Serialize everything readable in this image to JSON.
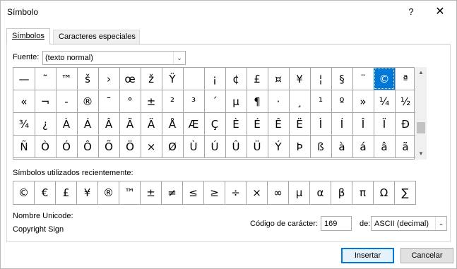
{
  "window": {
    "title": "Símbolo",
    "help_label": "?",
    "close_label": "✕"
  },
  "tabs": [
    {
      "label": "Símbolos",
      "active": true
    },
    {
      "label": "Caracteres especiales",
      "active": false
    }
  ],
  "font": {
    "label": "Fuente:",
    "value": "(texto normal)",
    "dropdown_icon": "chevron-down-icon"
  },
  "symbol_grid": {
    "rows": [
      [
        "—",
        "˜",
        "™",
        "š",
        "›",
        "œ",
        "ž",
        "Ÿ",
        " ",
        "¡",
        "¢",
        "£",
        "¤",
        "¥",
        "¦",
        "§",
        "¨",
        "©",
        "ª"
      ],
      [
        "«",
        "¬",
        "-",
        "®",
        "¯",
        "°",
        "±",
        "²",
        "³",
        "´",
        "µ",
        "¶",
        "·",
        "¸",
        "¹",
        "º",
        "»",
        "¼",
        "½"
      ],
      [
        "¾",
        "¿",
        "À",
        "Á",
        "Â",
        "Ã",
        "Ä",
        "Å",
        "Æ",
        "Ç",
        "È",
        "É",
        "Ê",
        "Ë",
        "Ì",
        "Í",
        "Î",
        "Ï",
        "Ð"
      ],
      [
        "Ñ",
        "Ò",
        "Ó",
        "Ô",
        "Õ",
        "Ö",
        "×",
        "Ø",
        "Ù",
        "Ú",
        "Û",
        "Ü",
        "Ý",
        "Þ",
        "ß",
        "à",
        "á",
        "â",
        "ã"
      ]
    ],
    "selected": "©",
    "selection_color": "#0078d7"
  },
  "recent": {
    "label": "Símbolos utilizados recientemente:",
    "symbols": [
      "©",
      "€",
      "£",
      "¥",
      "®",
      "™",
      "±",
      "≠",
      "≤",
      "≥",
      "÷",
      "×",
      "∞",
      "µ",
      "α",
      "β",
      "π",
      "Ω",
      "∑"
    ]
  },
  "unicode": {
    "name_label": "Nombre Unicode:",
    "name_value": "Copyright Sign"
  },
  "char_code": {
    "label": "Código de carácter:",
    "value": "169",
    "from_label": "de:",
    "from_value": "ASCII (decimal)"
  },
  "buttons": {
    "insert": "Insertar",
    "cancel": "Cancelar"
  },
  "scrollbar": {
    "up_icon": "scroll-up-icon",
    "down_icon": "scroll-down-icon"
  }
}
